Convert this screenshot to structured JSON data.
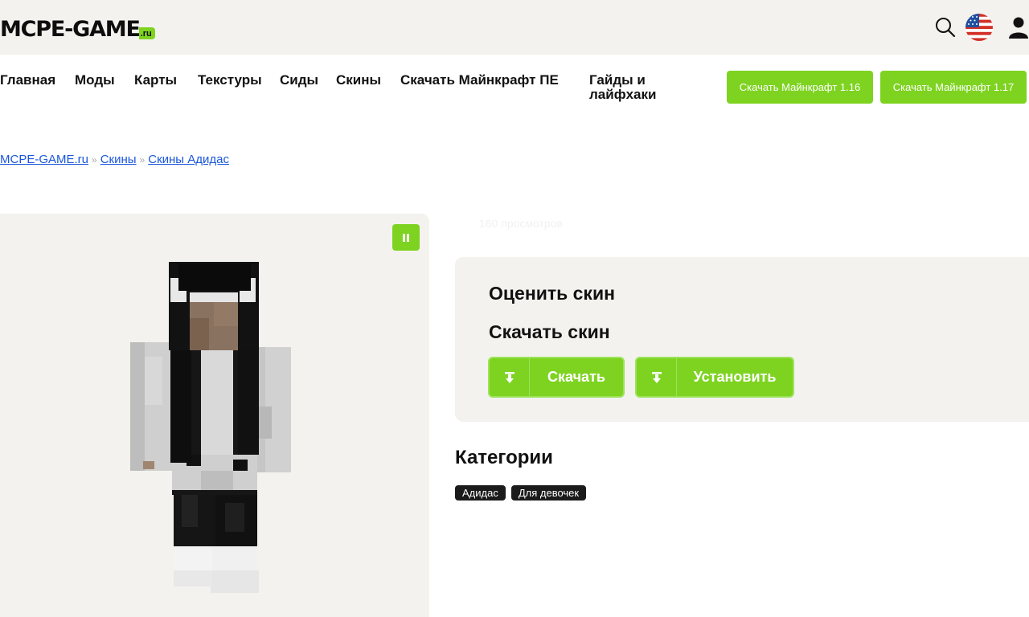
{
  "header": {
    "logo_main": "MCPE-GAME",
    "logo_suffix": ".ru",
    "icons": [
      "search-icon",
      "us-flag-icon",
      "user-icon"
    ]
  },
  "nav": {
    "items": [
      {
        "label": "Главная"
      },
      {
        "label": "Моды"
      },
      {
        "label": "Карты"
      },
      {
        "label": "Текстуры"
      },
      {
        "label": "Сиды"
      },
      {
        "label": "Скины"
      },
      {
        "label": "Скачать Майнкрафт ПЕ"
      },
      {
        "label": "Гайды и лайфхаки"
      }
    ],
    "buttons": [
      {
        "label": "Скачать Майнкрафт 1.16"
      },
      {
        "label": "Скачать Майнкрафт 1.17"
      }
    ]
  },
  "breadcrumb": {
    "items": [
      "MCPE-GAME.ru",
      "Скины",
      "Скины Адидас"
    ],
    "separator": "»"
  },
  "views": "160 просмотров",
  "panel": {
    "rate_title": "Оценить скин",
    "download_title": "Скачать скин",
    "download_button": "Скачать",
    "install_button": "Установить"
  },
  "categories": {
    "title": "Категории",
    "tags": [
      "Адидас",
      "Для девочек"
    ]
  },
  "colors": {
    "accent": "#7ed321",
    "header_bg": "#f4f2ee",
    "link": "#1a56db",
    "tag_bg": "#1b1b1b"
  }
}
